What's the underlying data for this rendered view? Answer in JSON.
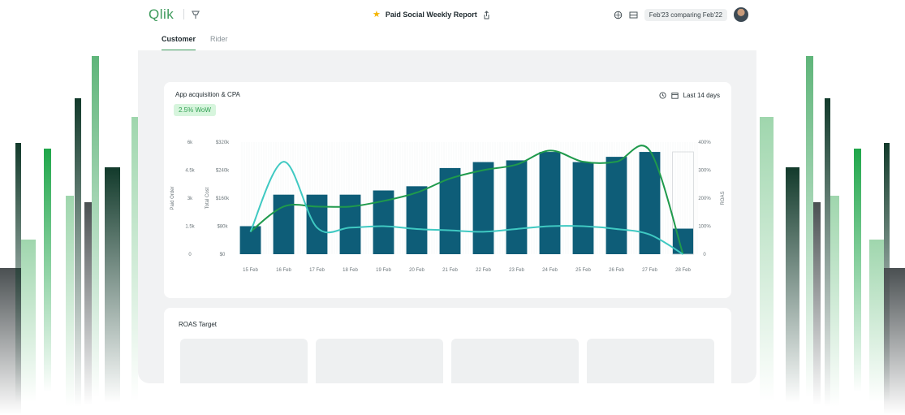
{
  "app": {
    "logo_text": "Qlik",
    "report_title": "Paid Social Weekly Report",
    "date_range": "Feb'23 comparing Feb'22",
    "icons": [
      "pin-icon",
      "star-icon",
      "share-icon",
      "globe-icon",
      "layout-icon",
      "avatar"
    ]
  },
  "tabs": [
    {
      "label": "Customer",
      "active": true
    },
    {
      "label": "Rider",
      "active": false
    }
  ],
  "card": {
    "title": "App acquisition & CPA",
    "badge": "2.5% WoW",
    "range_label": "Last 14 days"
  },
  "roas": {
    "title": "ROAS Target"
  },
  "colors": {
    "brand_green": "#3d9a5b",
    "bar_teal": "#0e5d78",
    "line_green": "#1f9a4c",
    "line_cyan": "#3fc9c2",
    "badge_bg": "#d7f5dd"
  },
  "chart_data": {
    "type": "bar",
    "categories": [
      "15 Feb",
      "16 Feb",
      "17 Feb",
      "18 Feb",
      "19 Feb",
      "20 Feb",
      "21 Feb",
      "22 Feb",
      "23 Feb",
      "24 Feb",
      "25 Feb",
      "26 Feb",
      "27 Feb",
      "28 Feb"
    ],
    "y_left_outer": {
      "label": "Paid Order",
      "ticks": [
        "0",
        "1.5k",
        "3k",
        "4.5k",
        "6k"
      ]
    },
    "y_left_inner": {
      "label": "Total Cost",
      "ticks": [
        "$0",
        "$80k",
        "$160k",
        "$240k",
        "$320k"
      ],
      "ylim": [
        0,
        320000
      ]
    },
    "y_right": {
      "label": "ROAS",
      "ticks": [
        "0",
        "100%",
        "200%",
        "300%",
        "400%"
      ],
      "ylim": [
        0,
        400
      ]
    },
    "series": [
      {
        "type": "bar",
        "axis": "left_inner",
        "values": [
          80000,
          170000,
          170000,
          170000,
          182000,
          194000,
          246000,
          263000,
          268000,
          292000,
          263000,
          278000,
          292000,
          73000
        ]
      },
      {
        "type": "line",
        "axis": "right",
        "values": [
          80,
          170,
          170,
          170,
          190,
          220,
          270,
          300,
          320,
          370,
          330,
          330,
          370,
          0
        ]
      },
      {
        "type": "line",
        "axis": "right",
        "values": [
          80,
          330,
          95,
          95,
          100,
          90,
          85,
          80,
          90,
          100,
          100,
          90,
          70,
          0
        ]
      }
    ],
    "last_bar_outline": true,
    "grid": false
  }
}
